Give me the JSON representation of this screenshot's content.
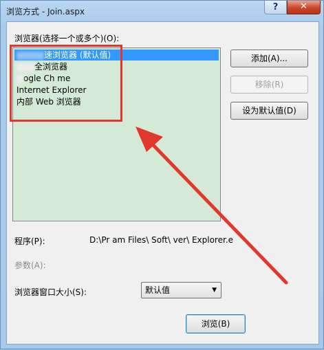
{
  "window": {
    "title": "浏览方式 - Join.aspx",
    "help_label": "?",
    "close_label": "✕"
  },
  "browsers": {
    "label": "浏览器(选择一个或多个)(O):",
    "items": [
      {
        "label": "速浏览器 (默认值)",
        "selected": true
      },
      {
        "label": "全浏览器",
        "selected": false
      },
      {
        "label": "ogle Ch   me",
        "selected": false
      },
      {
        "label": "Internet Explorer",
        "selected": false
      },
      {
        "label": "内部 Web 浏览器",
        "selected": false
      }
    ]
  },
  "buttons": {
    "add": "添加(A)...",
    "remove": "移除(R)",
    "set_default": "设为默认值(D)",
    "browse": "浏览(B)"
  },
  "program": {
    "label": "程序(P):",
    "value": "D:\\Pr    am Files\\    Soft\\       ver\\    Explorer.e"
  },
  "args": {
    "label": "参数(A):"
  },
  "window_size": {
    "label": "浏览器窗口大小(S):",
    "value": "默认值"
  },
  "colors": {
    "highlight": "#e0382d",
    "list_background": "#d5ead6",
    "selection": "#3399ff"
  }
}
